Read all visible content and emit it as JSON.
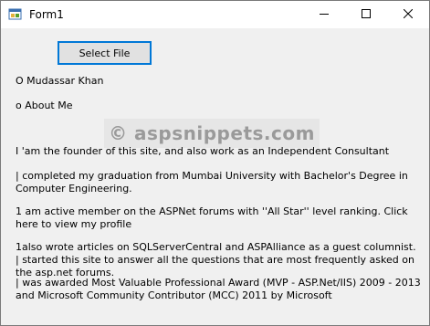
{
  "window": {
    "title": "Form1",
    "icon": "winforms-app-icon",
    "controls": {
      "minimize_icon": "minimize-icon",
      "maximize_icon": "maximize-icon",
      "close_icon": "close-icon"
    }
  },
  "form": {
    "select_file_label": "Select File",
    "heading1": "O Mudassar Khan",
    "heading2": "o About Me",
    "watermark": "© aspsnippets.com",
    "paragraphs": [
      "I 'am the founder of this site, and also work as an Independent Consultant",
      "| completed my graduation from Mumbai University with Bachelor's Degree in Computer Engineering.",
      "1 am active member on the ASPNet forums with ''All Star'' level ranking. Click here to view my profile",
      "1also wrote articles on SQLServerCentral and ASPAlliance as a guest columnist. | started this site to answer all the questions that are most frequently asked on the asp.net forums.",
      "| was awarded Most Valuable Professional Award (MVP - ASP.Net/IIS) 2009 - 2013 and Microsoft Community Contributor (MCC) 2011 by Microsoft"
    ]
  },
  "colors": {
    "form_background": "#f0f0f0",
    "titlebar_background": "#ffffff",
    "button_focus_border": "#0078d7",
    "watermark_text": "#9a9a9a"
  }
}
